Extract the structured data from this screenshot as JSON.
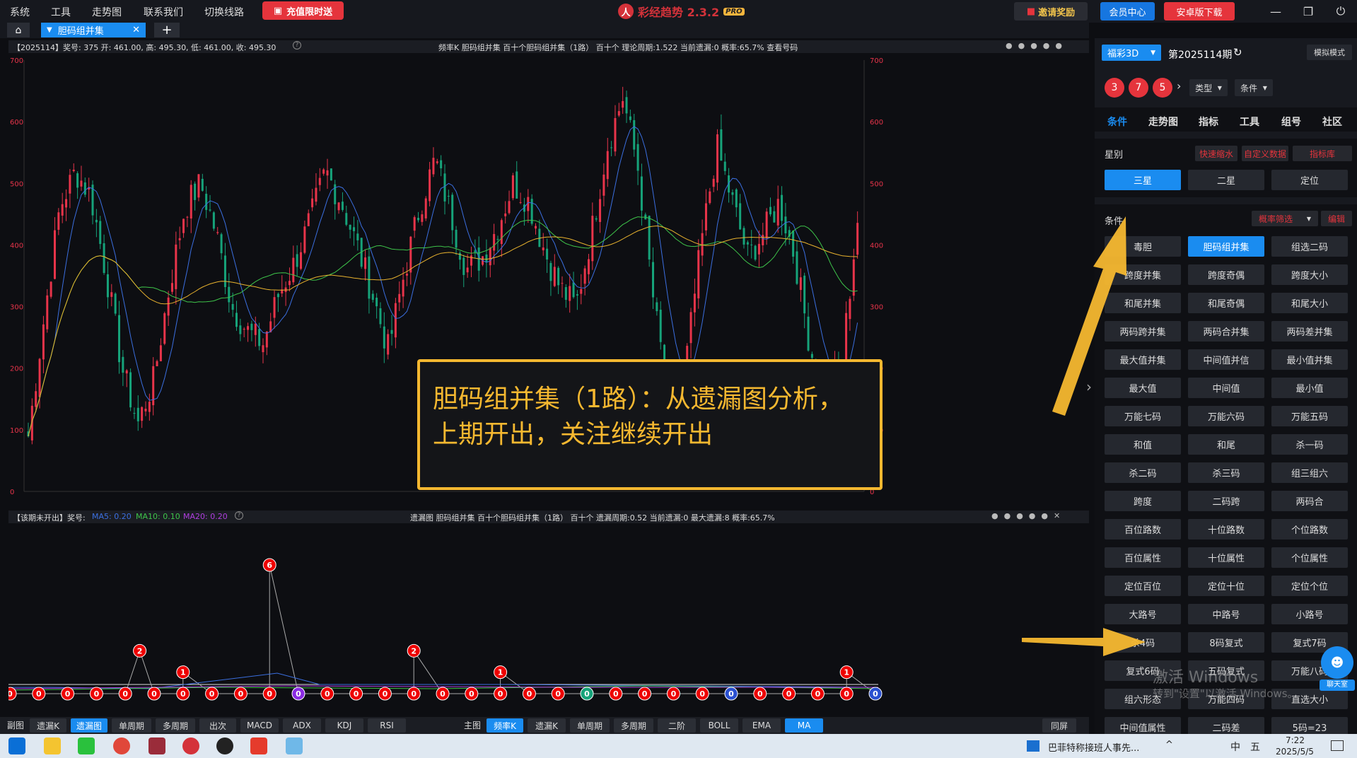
{
  "menubar": {
    "items": [
      "系统",
      "工具",
      "走势图",
      "联系我们",
      "切换线路"
    ],
    "recharge": "充值限时送",
    "app_name": "彩经趋势 2.3.2",
    "pro": "PRO",
    "invite": "邀请奖励",
    "member": "会员中心",
    "android": "安卓版下载"
  },
  "tabs": {
    "active": "胆码组并集",
    "home_icon": "home-icon",
    "add": "+",
    "close": "✕"
  },
  "main_chart": {
    "info_left": "【2025114】奖号: 375  开: 461.00, 高: 495.30, 低: 461.00, 收: 495.30",
    "info_mid": "频率K   胆码组并集   百十个胆码组并集（1路）   百十个   理论周期:1.522   当前遗漏:0   概率:65.7%   查看号码",
    "y_ticks": [
      "700",
      "600",
      "500",
      "400",
      "300",
      "200",
      "100",
      "0"
    ],
    "colors": {
      "up": "#e8344a",
      "down": "#16a37a",
      "ma5": "#3b6fe0",
      "ma10": "#3ec44a",
      "ma20": "#e8b22e"
    }
  },
  "missing_chart": {
    "info_left": "【该期未开出】奖号:",
    "ma5": "MA5: 0.20",
    "ma10": "MA10: 0.10",
    "ma20": "MA20: 0.20",
    "info_mid": "遗漏图   胆码组并集   百十个胆码组并集（1路）   百十个   遗漏周期:0.52   当前遗漏:0   最大遗漏:8   概率:65.7%",
    "zero_markers": [
      "0",
      "0",
      "0",
      "0",
      "0",
      "0",
      "0",
      "0",
      "0",
      "0",
      "0",
      "0",
      "0",
      "0",
      "0",
      "0",
      "0",
      "0",
      "0",
      "0",
      "0",
      "0",
      "0",
      "0",
      "0",
      "0",
      "0",
      "0",
      "0",
      "0",
      "0"
    ],
    "peaks": [
      {
        "label": "2"
      },
      {
        "label": "1"
      },
      {
        "label": "6"
      },
      {
        "label": "2"
      },
      {
        "label": "1"
      },
      {
        "label": "1"
      }
    ]
  },
  "annotation": {
    "line1": "胆码组并集（1路）：从遗漏图分析，",
    "line2": "上期开出，关注继续开出"
  },
  "bottom_bar": {
    "sub_label": "副图",
    "sub_buttons": [
      "遗漏K",
      "遗漏图",
      "单周期",
      "多周期",
      "出次",
      "MACD",
      "ADX",
      "KDJ",
      "RSI"
    ],
    "main_label": "主图",
    "main_buttons": [
      "频率K",
      "遗漏K",
      "单周期",
      "多周期",
      "二阶",
      "BOLL",
      "EMA",
      "MA"
    ],
    "same_screen": "同屏"
  },
  "sidebar": {
    "lottery": "福彩3D",
    "issue": "第2025114期",
    "sim_mode": "模拟模式",
    "balls": [
      "3",
      "7",
      "5"
    ],
    "type_label": "类型",
    "cond_label": "条件",
    "tabs": [
      "条件",
      "走势图",
      "指标",
      "工具",
      "组号",
      "社区"
    ],
    "star_label": "星别",
    "quick_shrink": "快速缩水",
    "custom_data": "自定义数据",
    "index_lib": "指标库",
    "star_options": [
      "三星",
      "二星",
      "定位"
    ],
    "cond_title": "条件",
    "prob_filter": "概率筛选",
    "edit": "编辑",
    "conditions": [
      "毒胆",
      "胆码组并集",
      "组选二码",
      "跨度并集",
      "跨度奇偶",
      "跨度大小",
      "和尾并集",
      "和尾奇偶",
      "和尾大小",
      "两码跨并集",
      "两码合并集",
      "两码差并集",
      "最大值并集",
      "中间值并信",
      "最小值并集",
      "最大值",
      "中间值",
      "最小值",
      "万能七码",
      "万能六码",
      "万能五码",
      "和值",
      "和尾",
      "杀一码",
      "杀二码",
      "杀三码",
      "组三组六",
      "跨度",
      "二码跨",
      "两码合",
      "百位路数",
      "十位路数",
      "个位路数",
      "百位属性",
      "十位属性",
      "个位属性",
      "定位百位",
      "定位十位",
      "定位个位",
      "大路号",
      "中路号",
      "小路号",
      "杀4码",
      "8码复式",
      "复式7码",
      "复式6码",
      "五码复式",
      "万能八码",
      "组六形态",
      "万能四码",
      "直选大小",
      "中间值属性",
      "二码差",
      "5码=23"
    ],
    "chat": "聊天室"
  },
  "watermark": {
    "line1": "激活 Windows",
    "line2": "转到\"设置\"以激活 Windows。"
  },
  "taskbar": {
    "news": "巴菲特称接班人事先...",
    "time": "7:22",
    "date": "2025/5/5",
    "ime": "中",
    "ime2": "五"
  }
}
